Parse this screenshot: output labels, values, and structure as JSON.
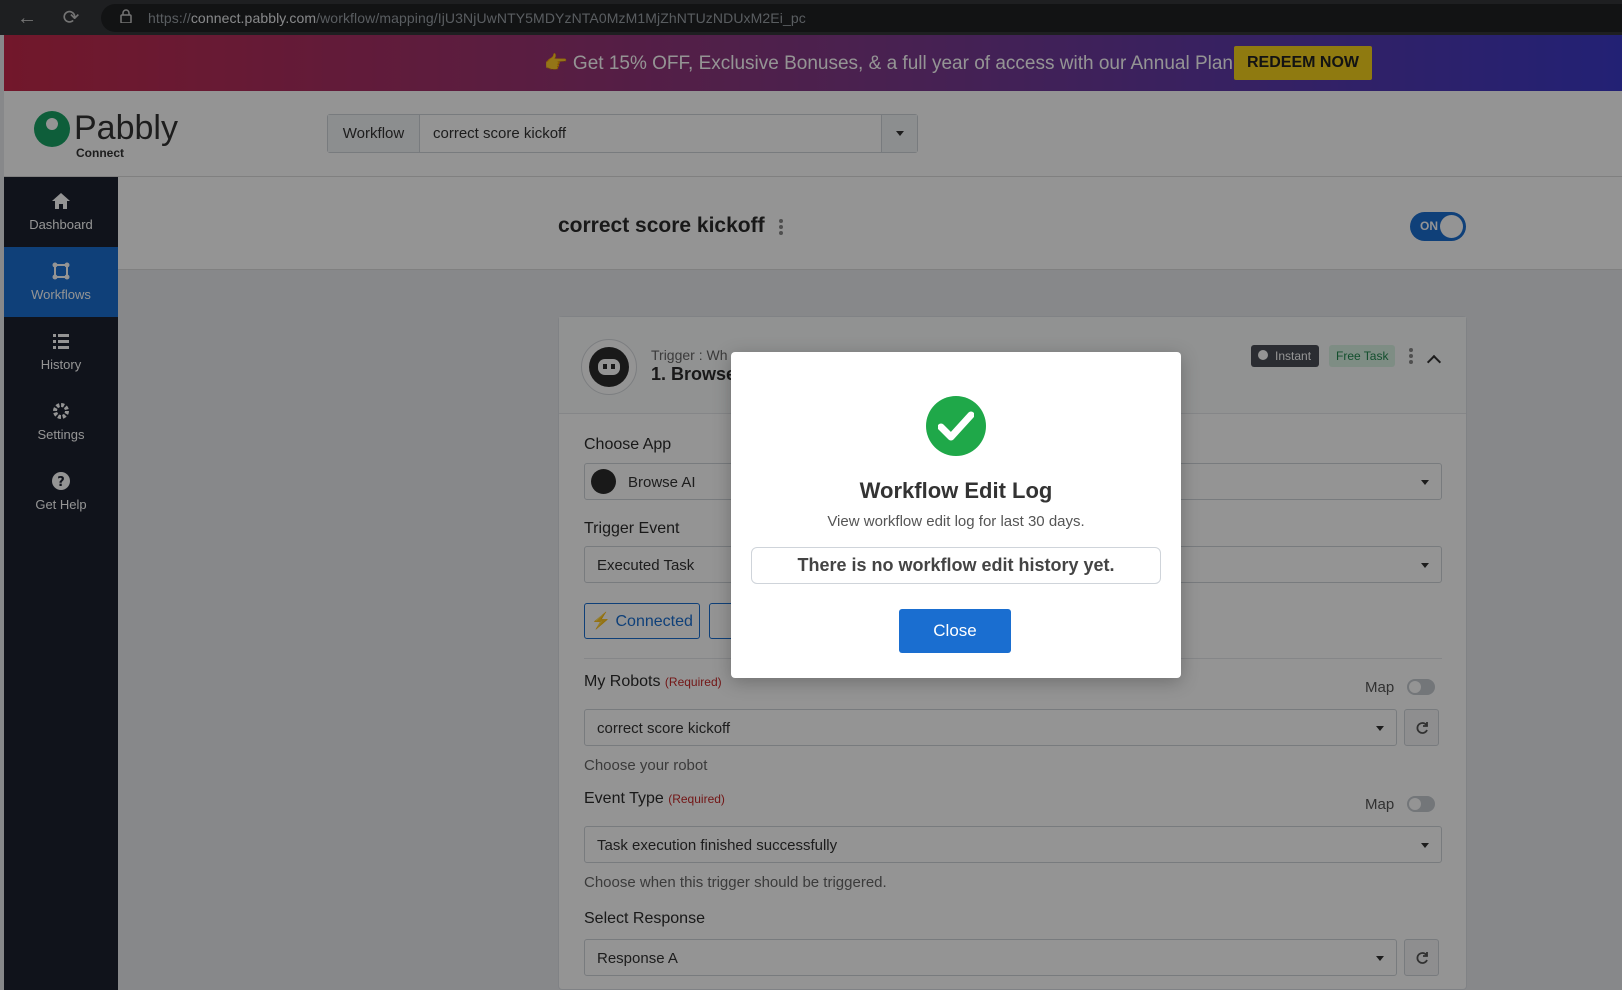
{
  "browser": {
    "url_prefix": "https://",
    "url_host": "connect.pabbly.com",
    "url_path": "/workflow/mapping/IjU3NjUwNTY5MDYzNTA0MzM1MjZhNTUzNDUxM2Ei_pc"
  },
  "promo": {
    "text": "👉 Get 15% OFF, Exclusive Bonuses, & a full year of access with our Annual Plan!",
    "button": "REDEEM NOW"
  },
  "header": {
    "logo_word": "Pabbly",
    "logo_sub": "Connect",
    "workflow_label": "Workflow",
    "workflow_value": "correct score kickoff"
  },
  "sidebar": {
    "items": [
      {
        "label": "Dashboard",
        "icon": "home-icon"
      },
      {
        "label": "Workflows",
        "icon": "workflow-icon",
        "active": true
      },
      {
        "label": "History",
        "icon": "list-icon"
      },
      {
        "label": "Settings",
        "icon": "gear-icon"
      },
      {
        "label": "Get Help",
        "icon": "help-icon"
      }
    ]
  },
  "page": {
    "title": "correct score kickoff",
    "toggle": "ON"
  },
  "trigger": {
    "label": "Trigger : Wh",
    "name": "1. Browse",
    "badge_instant": "Instant",
    "badge_free": "Free Task",
    "choose_app_label": "Choose App",
    "choose_app_value": "Browse AI",
    "trigger_event_label": "Trigger Event",
    "trigger_event_value": "Executed Task",
    "connected_button": "Connected",
    "robots_label": "My Robots",
    "required": "(Required)",
    "map_label": "Map",
    "robots_value": "correct score kickoff",
    "robots_hint": "Choose your robot",
    "event_type_label": "Event Type",
    "event_type_value": "Task execution finished successfully",
    "event_type_hint": "Choose when this trigger should be triggered.",
    "response_label": "Select Response",
    "response_value": "Response A"
  },
  "modal": {
    "title": "Workflow Edit Log",
    "subtitle": "View workflow edit log for last 30 days.",
    "empty": "There is no workflow edit history yet.",
    "close": "Close",
    "accent": "#1fa849"
  }
}
